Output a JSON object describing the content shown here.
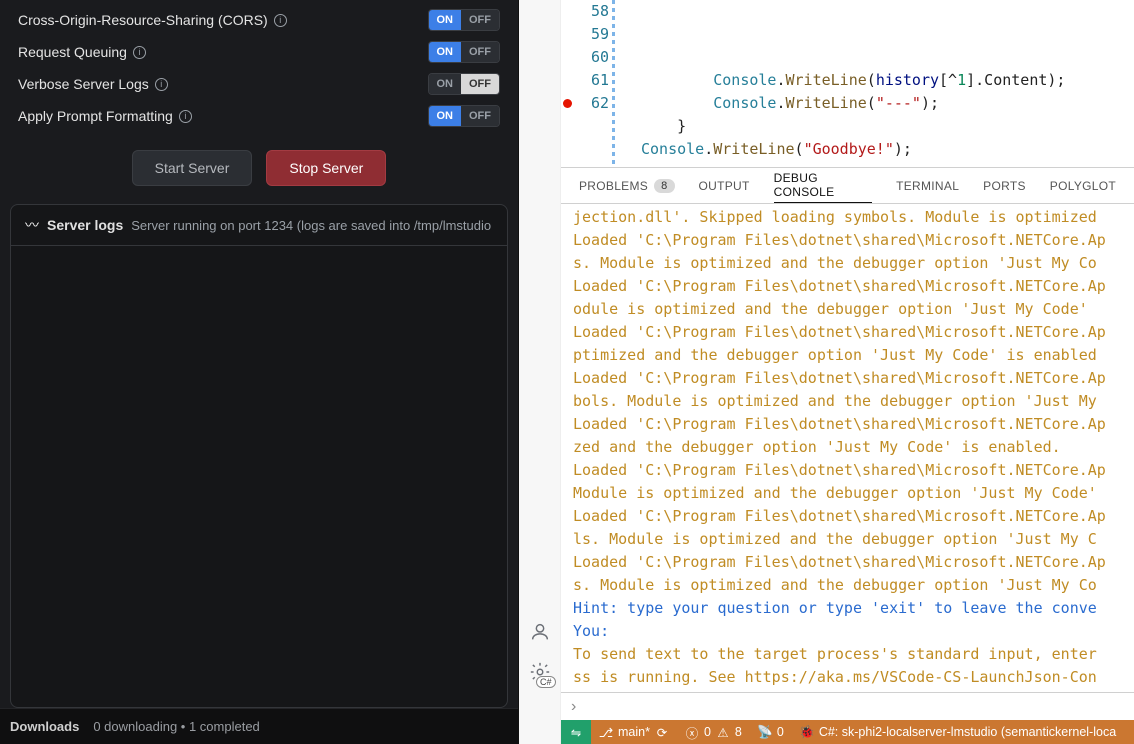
{
  "lmstudio": {
    "settings": [
      {
        "label": "Cross-Origin-Resource-Sharing (CORS)",
        "state": "on"
      },
      {
        "label": "Request Queuing",
        "state": "on"
      },
      {
        "label": "Verbose Server Logs",
        "state": "off"
      },
      {
        "label": "Apply Prompt Formatting",
        "state": "on"
      }
    ],
    "toggle_text": {
      "on": "ON",
      "off": "OFF"
    },
    "buttons": {
      "start": "Start Server",
      "stop": "Stop Server"
    },
    "logs": {
      "title": "Server logs",
      "status": "Server running on port 1234 (logs are saved into /tmp/lmstudio"
    },
    "downloads": {
      "label": "Downloads",
      "detail": "0 downloading  •  1 completed"
    }
  },
  "vscode": {
    "editor": {
      "lines": [
        {
          "num": "58",
          "tokens": [
            {
              "t": "        ",
              "c": ""
            },
            {
              "t": "Console",
              "c": "cls"
            },
            {
              "t": ".",
              "c": ""
            },
            {
              "t": "WriteLine",
              "c": "mth"
            },
            {
              "t": "(",
              "c": ""
            },
            {
              "t": "history",
              "c": "var"
            },
            {
              "t": "[^",
              "c": ""
            },
            {
              "t": "1",
              "c": "num"
            },
            {
              "t": "].Content);",
              "c": ""
            }
          ]
        },
        {
          "num": "59",
          "tokens": [
            {
              "t": "        ",
              "c": ""
            },
            {
              "t": "Console",
              "c": "cls"
            },
            {
              "t": ".",
              "c": ""
            },
            {
              "t": "WriteLine",
              "c": "mth"
            },
            {
              "t": "(",
              "c": ""
            },
            {
              "t": "\"---\"",
              "c": "str"
            },
            {
              "t": ");",
              "c": ""
            }
          ]
        },
        {
          "num": "60",
          "tokens": [
            {
              "t": "    }",
              "c": ""
            }
          ]
        },
        {
          "num": "61",
          "tokens": [
            {
              "t": "",
              "c": ""
            }
          ]
        },
        {
          "num": "62",
          "bp": true,
          "tokens": [
            {
              "t": "",
              "c": ""
            },
            {
              "t": "Console",
              "c": "cls"
            },
            {
              "t": ".",
              "c": ""
            },
            {
              "t": "WriteLine",
              "c": "mth"
            },
            {
              "t": "(",
              "c": ""
            },
            {
              "t": "\"Goodbye!\"",
              "c": "str"
            },
            {
              "t": ");",
              "c": ""
            }
          ]
        }
      ]
    },
    "panel": {
      "tabs": {
        "problems": "PROBLEMS",
        "problems_count": "8",
        "output": "OUTPUT",
        "debug": "DEBUG CONSOLE",
        "terminal": "TERMINAL",
        "ports": "PORTS",
        "polyglot": "POLYGLOT"
      },
      "debug_lines": [
        {
          "t": "jection.dll'. Skipped loading symbols. Module is optimized",
          "c": ""
        },
        {
          "t": "Loaded 'C:\\Program Files\\dotnet\\shared\\Microsoft.NETCore.Ap",
          "c": ""
        },
        {
          "t": "s. Module is optimized and the debugger option 'Just My Co",
          "c": ""
        },
        {
          "t": "Loaded 'C:\\Program Files\\dotnet\\shared\\Microsoft.NETCore.Ap",
          "c": ""
        },
        {
          "t": "odule is optimized and the debugger option 'Just My Code' ",
          "c": ""
        },
        {
          "t": "Loaded 'C:\\Program Files\\dotnet\\shared\\Microsoft.NETCore.Ap",
          "c": ""
        },
        {
          "t": "ptimized and the debugger option 'Just My Code' is enabled",
          "c": ""
        },
        {
          "t": "Loaded 'C:\\Program Files\\dotnet\\shared\\Microsoft.NETCore.Ap",
          "c": ""
        },
        {
          "t": "bols. Module is optimized and the debugger option 'Just My",
          "c": ""
        },
        {
          "t": "Loaded 'C:\\Program Files\\dotnet\\shared\\Microsoft.NETCore.Ap",
          "c": ""
        },
        {
          "t": "zed and the debugger option 'Just My Code' is enabled.",
          "c": ""
        },
        {
          "t": "Loaded 'C:\\Program Files\\dotnet\\shared\\Microsoft.NETCore.Ap",
          "c": ""
        },
        {
          "t": "Module is optimized and the debugger option 'Just My Code'",
          "c": ""
        },
        {
          "t": "Loaded 'C:\\Program Files\\dotnet\\shared\\Microsoft.NETCore.Ap",
          "c": ""
        },
        {
          "t": "ls. Module is optimized and the debugger option 'Just My C",
          "c": ""
        },
        {
          "t": "Loaded 'C:\\Program Files\\dotnet\\shared\\Microsoft.NETCore.Ap",
          "c": ""
        },
        {
          "t": "s. Module is optimized and the debugger option 'Just My Co",
          "c": ""
        },
        {
          "t": "Hint: type your question or type 'exit' to leave the conve",
          "c": "hint"
        },
        {
          "t": "You:",
          "c": "you"
        },
        {
          "t": "To send text to the target process's standard input, enter",
          "c": ""
        },
        {
          "t": "ss is running. See https://aka.ms/VSCode-CS-LaunchJson-Con",
          "c": ""
        }
      ],
      "input_prompt": "›"
    },
    "status": {
      "remote_icon": "⇋",
      "branch": "main*",
      "sync_icon": "⟳",
      "errors": "0",
      "warnings": "8",
      "ports": "0",
      "debug_target": "C#: sk-phi2-localserver-lmstudio (semantickernel-loca"
    }
  }
}
